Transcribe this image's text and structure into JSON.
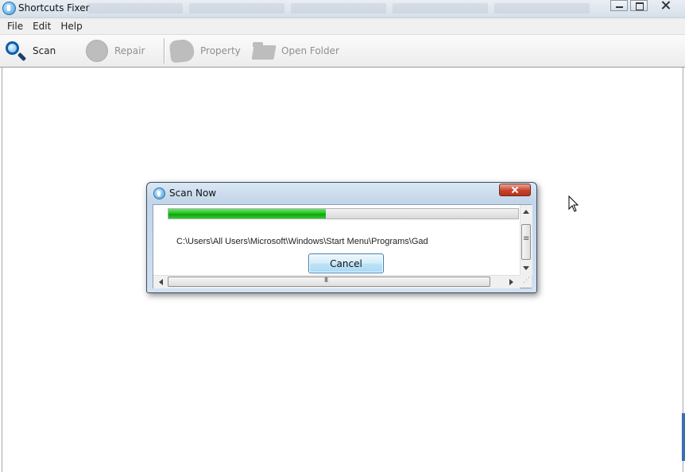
{
  "window": {
    "title": "Shortcuts Fixer"
  },
  "menu": [
    {
      "label": "File"
    },
    {
      "label": "Edit"
    },
    {
      "label": "Help"
    }
  ],
  "toolbar": {
    "scan_label": "Scan",
    "repair_label": "Repair",
    "property_label": "Property",
    "open_folder_label": "Open Folder"
  },
  "dialog": {
    "title": "Scan Now",
    "progress_percent": 45,
    "current_path": "C:\\Users\\All Users\\Microsoft\\Windows\\Start Menu\\Programs\\Gad",
    "cancel_label": "Cancel"
  },
  "colors": {
    "progress_green": "#22c322",
    "close_red": "#c9432a",
    "accent_blue": "#3c7fb1"
  }
}
